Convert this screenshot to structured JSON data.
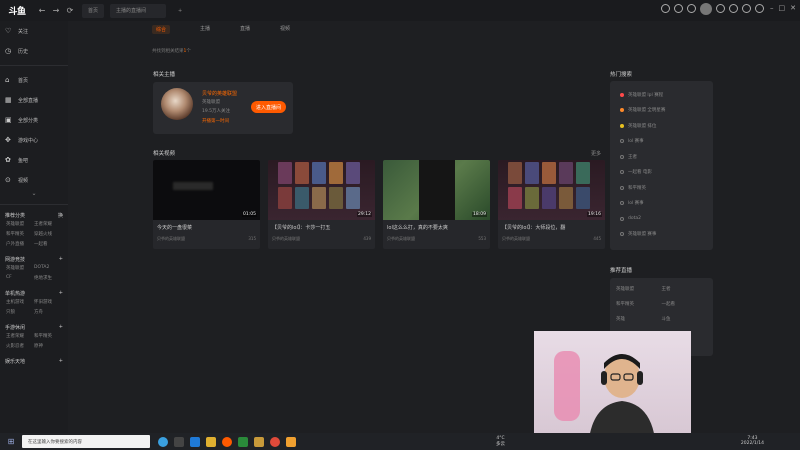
{
  "topbar": {
    "logo": "斗鱼",
    "nav": {
      "back": "←",
      "forward": "→",
      "refresh": "⟳"
    },
    "tabs": [
      {
        "label": "首页"
      },
      {
        "label": "主播的直播间"
      },
      {
        "label": "+"
      }
    ]
  },
  "sidebar": {
    "items": [
      {
        "icon": "heart-icon",
        "glyph": "♡",
        "label": "关注"
      },
      {
        "icon": "clock-icon",
        "glyph": "◷",
        "label": "历史"
      },
      {
        "icon": "home-icon",
        "glyph": "⌂",
        "label": "首页"
      },
      {
        "icon": "grid-icon",
        "glyph": "▦",
        "label": "全部直播"
      },
      {
        "icon": "category-icon",
        "glyph": "▣",
        "label": "全部分类"
      },
      {
        "icon": "game-icon",
        "glyph": "✥",
        "label": "游戏中心"
      },
      {
        "icon": "fishbar-icon",
        "glyph": "✿",
        "label": "鱼吧"
      },
      {
        "icon": "video-icon",
        "glyph": "⊙",
        "label": "视频"
      }
    ],
    "expand": "⌄",
    "groups": [
      {
        "title": "推荐分类",
        "action": "换",
        "cells": [
          "英雄联盟",
          "王者荣耀",
          "和平精英",
          "穿越火线",
          "户外直播",
          "一起看"
        ]
      },
      {
        "title": "网游竞技",
        "action": "+",
        "cells": [
          "英雄联盟",
          "DOTA2",
          "CF",
          "绝地求生"
        ]
      },
      {
        "title": "单机热游",
        "action": "+",
        "cells": [
          "主机游戏",
          "怀旧游戏",
          "只狼",
          "方舟"
        ]
      },
      {
        "title": "手游休闲",
        "action": "+",
        "cells": [
          "王者荣耀",
          "和平精英",
          "火影忍者",
          "原神"
        ]
      },
      {
        "title": "娱乐天地",
        "action": "+",
        "cells": []
      }
    ]
  },
  "main": {
    "tabs": [
      {
        "label": "综合",
        "active": true
      },
      {
        "label": "主播",
        "active": false
      },
      {
        "label": "直播",
        "active": false
      },
      {
        "label": "视频",
        "active": false
      }
    ],
    "result_prefix": "共找到相关结果",
    "result_count": "1",
    "result_suffix": "个",
    "anchor_section": "相关主播",
    "anchor": {
      "name": "贝爷的英雄联盟",
      "line1": "英雄联盟",
      "line2": "19.5万人关注",
      "line3": "开播第一时间",
      "enter": "进入直播间"
    },
    "video_section": "相关视频",
    "more": "更多",
    "videos": [
      {
        "title": "今天的一盘很菜",
        "author": "贝爷的英雄联盟",
        "count": "315",
        "duration": "01:05"
      },
      {
        "title": "【贝爷的lol】：卡莎一打五",
        "author": "贝爷的英雄联盟",
        "count": "439",
        "duration": "29:12"
      },
      {
        "title": "lol这么么打，真的不要太爽",
        "author": "贝爷的英雄联盟",
        "count": "553",
        "duration": "18:09"
      },
      {
        "title": "【贝爷的lol】：大师段位，翻",
        "author": "贝爷的英雄联盟",
        "count": "445",
        "duration": "19:16"
      }
    ],
    "hot_title": "热门搜索",
    "hot": [
      {
        "label": "英雄联盟 lpl 赛程",
        "color": "#ff4a4a"
      },
      {
        "label": "英雄联盟 全明星赛",
        "color": "#ff8a2a"
      },
      {
        "label": "英雄联盟 排位",
        "color": "#e8c020"
      },
      {
        "label": "lol 赛事",
        "color": ""
      },
      {
        "label": "王者",
        "color": ""
      },
      {
        "label": "一起看 电影",
        "color": ""
      },
      {
        "label": "和平精英",
        "color": ""
      },
      {
        "label": "lol 赛事",
        "color": ""
      },
      {
        "label": "dota2",
        "color": ""
      },
      {
        "label": "英雄联盟 赛事",
        "color": ""
      }
    ],
    "rec_title": "推荐直播",
    "rec": [
      "英雄联盟",
      "王者",
      "和平精英",
      "一起看",
      "英雄",
      "斗鱼"
    ]
  },
  "taskbar": {
    "start": "⊞",
    "search_placeholder": "在这里输入你要搜索的内容",
    "weather_temp": "4°C",
    "weather_desc": "多云",
    "time": "7:43",
    "date": "2022/1/14"
  },
  "colors": {
    "accent": "#ff5a00",
    "bg": "#1e1f22",
    "panel": "#2a2b2f"
  }
}
